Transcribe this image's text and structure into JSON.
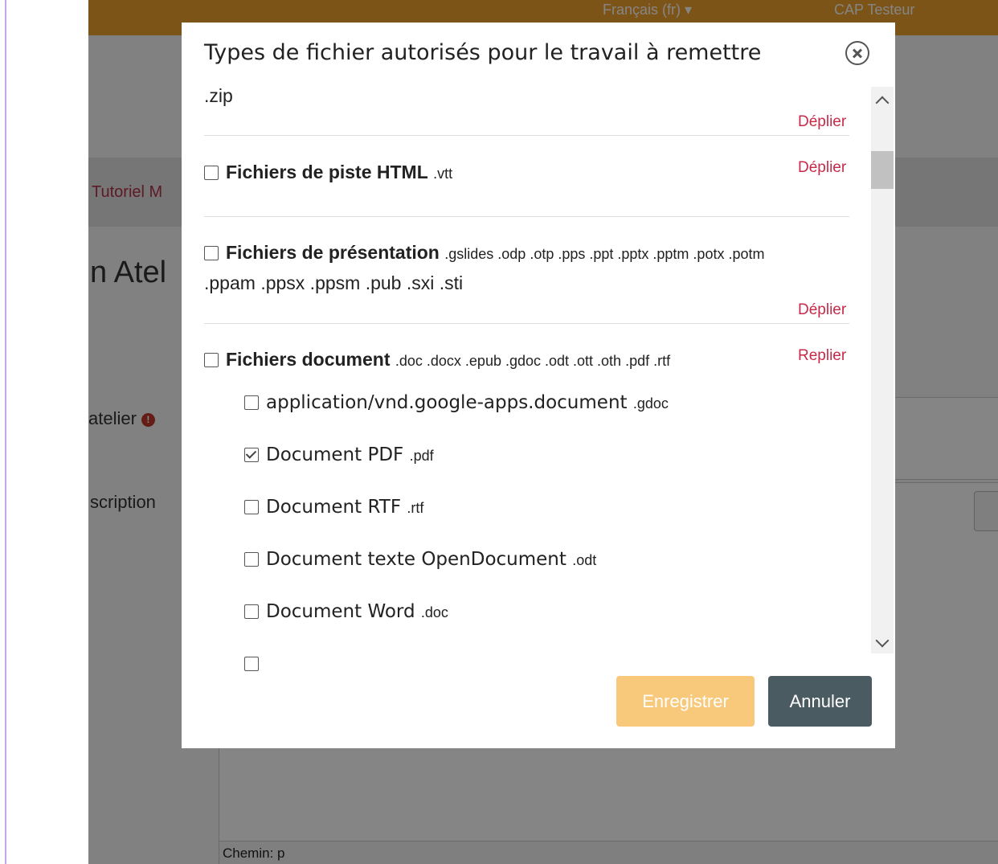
{
  "background": {
    "topbar": {
      "language": "Français (fr) ▾",
      "user": "CAP Testeur"
    },
    "breadcrumb": "Tutoriel M",
    "page_title": "n Atel",
    "labels": {
      "name": "atelier",
      "description": "scription"
    },
    "editor_path": "Chemin: p"
  },
  "modal": {
    "title": "Types de fichier autorisés pour le travail à remettre",
    "top_extensions": ".zip",
    "top_toggle": "Déplier",
    "categories": [
      {
        "name": "Fichiers de piste HTML",
        "extensions": ".vtt",
        "toggle": "Déplier",
        "checked": false
      },
      {
        "name": "Fichiers de présentation",
        "extensions": ".gslides .odp .otp .pps .ppt .pptx .pptm .potx .potm",
        "extensions_line2": ".ppam .ppsx .ppsm .pub .sxi .sti",
        "toggle": "Déplier",
        "checked": false
      },
      {
        "name": "Fichiers document",
        "extensions": ".doc .docx .epub .gdoc .odt .ott .oth .pdf .rtf",
        "toggle": "Replier",
        "checked": false
      }
    ],
    "subtypes": [
      {
        "name": "application/vnd.google-apps.document",
        "ext": ".gdoc",
        "checked": false
      },
      {
        "name": "Document PDF",
        "ext": ".pdf",
        "checked": true
      },
      {
        "name": "Document RTF",
        "ext": ".rtf",
        "checked": false
      },
      {
        "name": "Document texte OpenDocument",
        "ext": ".odt",
        "checked": false
      },
      {
        "name": "Document Word",
        "ext": ".doc",
        "checked": false
      }
    ],
    "buttons": {
      "save": "Enregistrer",
      "cancel": "Annuler"
    }
  }
}
